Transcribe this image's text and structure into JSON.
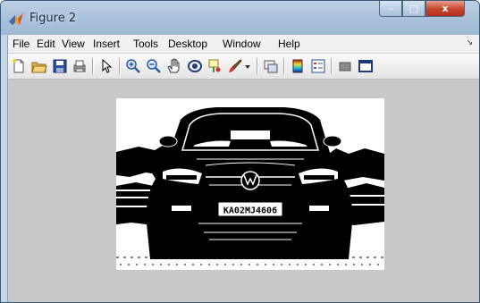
{
  "window": {
    "title": "Figure 2",
    "controls": {
      "minimize": "–",
      "maximize": "□",
      "close": "x"
    }
  },
  "menu": [
    "File",
    "Edit",
    "View",
    "Insert",
    "Tools",
    "Desktop",
    "Window",
    "Help"
  ],
  "toolbar": {
    "icons": [
      "new-figure-icon",
      "open-file-icon",
      "save-icon",
      "print-icon",
      "pointer-icon",
      "zoom-in-icon",
      "zoom-out-icon",
      "pan-hand-icon",
      "rotate-3d-icon",
      "data-cursor-icon",
      "brush-icon",
      "dropdown-icon",
      "link-plot-icon",
      "colorbar-icon",
      "legend-icon",
      "hide-plot-tools-icon",
      "show-plot-tools-icon"
    ]
  },
  "figure": {
    "image_alt": "Binarized black and white image of car front",
    "plate_text": "KA02MJ4606",
    "background_color": "#c8c8c8"
  }
}
